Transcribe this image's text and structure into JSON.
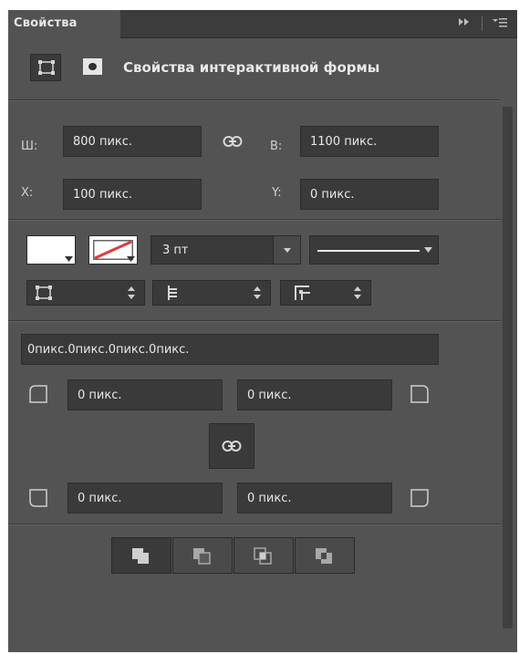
{
  "panel": {
    "tab_label": "Свойства",
    "collapse_icon": "double-chevron-right-icon",
    "menu_icon": "panel-menu-icon"
  },
  "header": {
    "title": "Свойства интерактивной формы",
    "shape_icon": "shape-properties-icon",
    "mask_icon": "mask-properties-icon"
  },
  "transform": {
    "w_label": "Ш:",
    "w_value": "800 пикс.",
    "h_label": "В:",
    "h_value": "1100 пикс.",
    "x_label": "X:",
    "x_value": "100 пикс.",
    "y_label": "Y:",
    "y_value": "0 пикс."
  },
  "appearance": {
    "fill_color": "#ffffff",
    "stroke_icon": "no-stroke-icon",
    "stroke_width": "3 пт",
    "stroke_style": "solid-line",
    "align_icon": "stroke-align-icon",
    "caps_icon": "stroke-caps-icon",
    "corners_icon": "stroke-corners-icon"
  },
  "corners": {
    "summary": "0пикс.0пикс.0пикс.0пикс.",
    "top_left": "0 пикс.",
    "top_right": "0 пикс.",
    "bottom_left": "0 пикс.",
    "bottom_right": "0 пикс."
  },
  "path_ops": [
    {
      "name": "combine-shapes-icon"
    },
    {
      "name": "subtract-front-shape-icon"
    },
    {
      "name": "intersect-shapes-icon"
    },
    {
      "name": "exclude-overlap-icon"
    }
  ],
  "colors": {
    "panel_bg": "#535353",
    "field_bg": "#3a3a3a",
    "accent_red": "#e23b3b"
  }
}
